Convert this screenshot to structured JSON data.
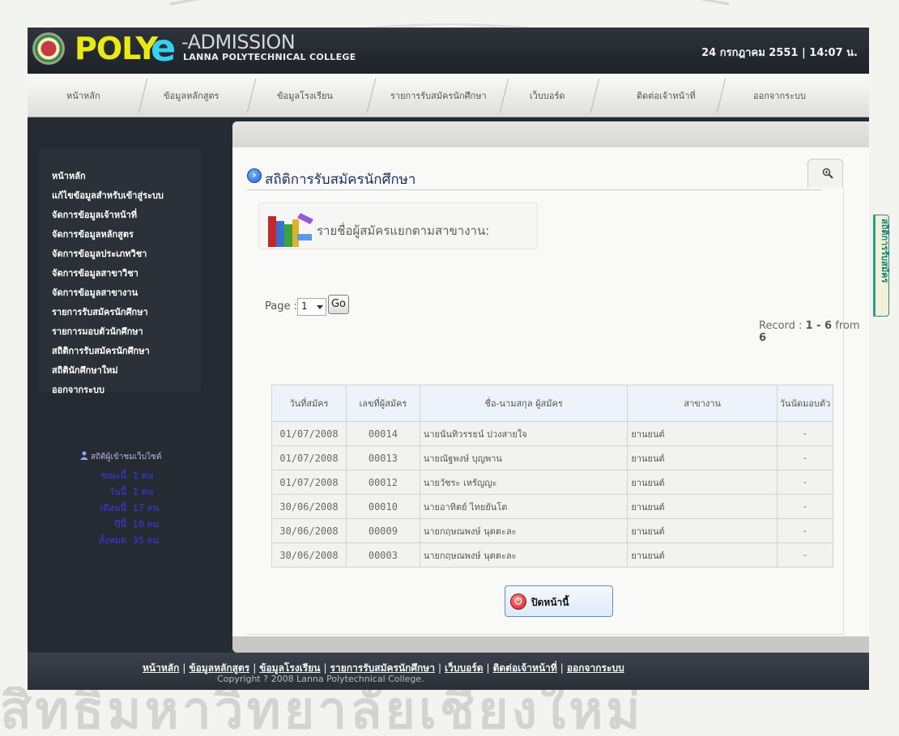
{
  "header": {
    "logo_poly": "POLY",
    "logo_e": "e",
    "logo_admission": "-ADMISSION",
    "logo_college": "LANNA POLYTECHNICAL COLLEGE",
    "datetime": "24 กรกฎาคม 2551  |  14:07 น."
  },
  "nav": {
    "items": [
      "หน้าหลัก",
      "ข้อมูลหลักสูตร",
      "ข้อมูลโรงเรียน",
      "รายการรับสมัครนักศึกษา",
      "เว็บบอร์ด",
      "ติดต่อเจ้าหน้าที่",
      "ออกจากระบบ"
    ]
  },
  "sidebar": {
    "items": [
      "หน้าหลัก",
      "แก้ไขข้อมูลสำหรับเข้าสู่ระบบ",
      "จัดการข้อมูลเจ้าหน้าที่",
      "จัดการข้อมูลหลักสูตร",
      "จัดการข้อมูลประเภทวิชา",
      "จัดการข้อมูลสาขาวิชา",
      "จัดการข้อมูลสาขางาน",
      "รายการรับสมัครนักศึกษา",
      "รายการมอบตัวนักศึกษา",
      "สถิติการรับสมัครนักศึกษา",
      "สถิตินักศึกษาใหม่",
      "ออกจากระบบ"
    ]
  },
  "visitor_stats": {
    "title": "สถิติผู้เข้าชมเว็บไซต์",
    "rows": [
      {
        "label": "ขณะนี้",
        "value": "1 คน"
      },
      {
        "label": "วันนี้",
        "value": "1 คน"
      },
      {
        "label": "เดือนนี้",
        "value": "17 คน"
      },
      {
        "label": "ปีนี้",
        "value": "18 คน"
      },
      {
        "label": "ทั้งหมด",
        "value": "35 คน"
      }
    ]
  },
  "page": {
    "title": "สถิติการรับสมัครนักศึกษา",
    "subtitle": "รายชื่อผู้สมัครแยกตามสาขางาน:",
    "page_label": "Page :",
    "page_value": "1",
    "go_label": "Go",
    "record_prefix": "Record : ",
    "record_range": "1 - 6",
    "record_from": " from ",
    "record_total": "6",
    "close_label": "ปิดหน้านี้"
  },
  "table": {
    "headers": [
      "วันที่สมัคร",
      "เลขที่ผู้สมัคร",
      "ชื่อ-นามสกุล ผู้สมัคร",
      "สาขางาน",
      "วันนัดมอบตัว"
    ],
    "rows": [
      [
        "01/07/2008",
        "00014",
        "นายนันทิวรรธน์  ปวงสายใจ",
        "ยานยนต์",
        "-"
      ],
      [
        "01/07/2008",
        "00013",
        "นายณัฐพงษ์  บุญพาน",
        "ยานยนต์",
        "-"
      ],
      [
        "01/07/2008",
        "00012",
        "นายวัชระ  เหรัญญะ",
        "ยานยนต์",
        "-"
      ],
      [
        "30/06/2008",
        "00010",
        "นายอาทิตย์  ไทยยันโต",
        "ยานยนต์",
        "-"
      ],
      [
        "30/06/2008",
        "00009",
        "นายกฤษณพงษ์  นุตตะละ",
        "ยานยนต์",
        "-"
      ],
      [
        "30/06/2008",
        "00003",
        "นายกฤษณพงษ์  นุตตะละ",
        "ยานยนต์",
        "-"
      ]
    ]
  },
  "footer": {
    "links": [
      "หน้าหลัก",
      "ข้อมูลหลักสูตร",
      "ข้อมูลโรงเรียน",
      "รายการรับสมัครนักศึกษา",
      "เว็บบอร์ด",
      "ติดต่อเจ้าหน้าที่",
      "ออกจากระบบ"
    ],
    "separator": "|",
    "copyright": "Copyright ? 2008 Lanna Polytechnical College."
  },
  "side_tab": "สถิติการรับสมัคร",
  "watermark": "สิทธิ์มหาวิทยาลัยเชียงใหม่"
}
